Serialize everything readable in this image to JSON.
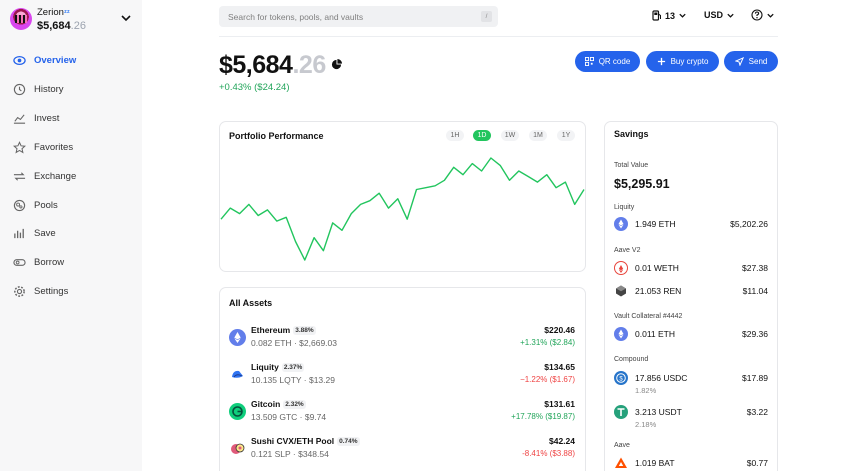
{
  "account": {
    "name": "Zerion",
    "badge": "ᶻᶻ",
    "value_main": "$5,684",
    "value_cents": ".26"
  },
  "nav": [
    {
      "label": "Overview",
      "icon": "eye-icon"
    },
    {
      "label": "History",
      "icon": "history-icon"
    },
    {
      "label": "Invest",
      "icon": "chart-line-icon"
    },
    {
      "label": "Favorites",
      "icon": "star-icon"
    },
    {
      "label": "Exchange",
      "icon": "exchange-icon"
    },
    {
      "label": "Pools",
      "icon": "pools-icon"
    },
    {
      "label": "Save",
      "icon": "bars-icon"
    },
    {
      "label": "Borrow",
      "icon": "borrow-icon"
    },
    {
      "label": "Settings",
      "icon": "gear-icon"
    }
  ],
  "search": {
    "placeholder": "Search for tokens, pools, and vaults",
    "shortcut": "/"
  },
  "topbar": {
    "gas": "13",
    "currency": "USD"
  },
  "balance": {
    "main": "$5,684",
    "cents": ".26",
    "change": "+0.43% ($24.24)"
  },
  "actions": {
    "qr": "QR code",
    "buy": "Buy crypto",
    "send": "Send"
  },
  "performance": {
    "title": "Portfolio Performance",
    "periods": [
      "1H",
      "1D",
      "1W",
      "1M",
      "1Y"
    ],
    "active_period": "1D",
    "line_color": "#22c55e"
  },
  "chart_data": {
    "type": "line",
    "title": "Portfolio Performance",
    "xlabel": "",
    "ylabel": "",
    "x": [
      0,
      1,
      2,
      3,
      4,
      5,
      6,
      7,
      8,
      9,
      10,
      11,
      12,
      13,
      14,
      15,
      16,
      17,
      18,
      19,
      20,
      21,
      22,
      23,
      24,
      25,
      26,
      27,
      28,
      29,
      30,
      31,
      32,
      33,
      34,
      35,
      36,
      37,
      38,
      39
    ],
    "y": [
      5662,
      5668,
      5665,
      5670,
      5664,
      5667,
      5661,
      5663,
      5650,
      5640,
      5652,
      5645,
      5660,
      5656,
      5665,
      5670,
      5672,
      5676,
      5668,
      5673,
      5662,
      5678,
      5679,
      5680,
      5683,
      5690,
      5686,
      5692,
      5688,
      5695,
      5691,
      5683,
      5688,
      5685,
      5682,
      5686,
      5679,
      5682,
      5670,
      5678
    ]
  },
  "assets": {
    "title": "All Assets",
    "items": [
      {
        "name": "Ethereum",
        "pct": "3.88%",
        "sub": "0.082 ETH · $2,669.03",
        "value": "$220.46",
        "delta": "+1.31% ($2.84)",
        "dir": "pos",
        "color": "#627eea"
      },
      {
        "name": "Liquity",
        "pct": "2.37%",
        "sub": "10.135 LQTY · $13.29",
        "value": "$134.65",
        "delta": "−1.22% ($1.67)",
        "dir": "neg",
        "color": "#2f74f3"
      },
      {
        "name": "Gitcoin",
        "pct": "2.32%",
        "sub": "13.509 GTC · $9.74",
        "value": "$131.61",
        "delta": "+17.78% ($19.87)",
        "dir": "pos",
        "color": "#0fce7c"
      },
      {
        "name": "Sushi CVX/ETH Pool",
        "pct": "0.74%",
        "sub": "0.121 SLP · $348.54",
        "value": "$42.24",
        "delta": "-8.41% ($3.88)",
        "dir": "neg",
        "color": "#e05a7a"
      }
    ]
  },
  "savings": {
    "title": "Savings",
    "total_label": "Total Value",
    "total": "$5,295.91",
    "groups": [
      {
        "label": "Liquity",
        "rows": [
          {
            "amount": "1.949 ETH",
            "value": "$5,202.26",
            "icon": "eth-icon",
            "color": "#627eea"
          }
        ]
      },
      {
        "label": "Aave V2",
        "rows": [
          {
            "amount": "0.01 WETH",
            "value": "$27.38",
            "icon": "weth-icon",
            "color": "#e8453c"
          },
          {
            "amount": "21.053 REN",
            "value": "$11.04",
            "icon": "ren-icon",
            "color": "#444444"
          }
        ]
      },
      {
        "label": "Vault Collateral #4442",
        "rows": [
          {
            "amount": "0.011 ETH",
            "value": "$29.36",
            "icon": "eth-icon",
            "color": "#627eea"
          }
        ]
      },
      {
        "label": "Compound",
        "rows": [
          {
            "amount": "17.856 USDC",
            "sub": "1.82%",
            "value": "$17.89",
            "icon": "usdc-icon",
            "color": "#2775ca"
          },
          {
            "amount": "3.213 USDT",
            "sub": "2.18%",
            "value": "$3.22",
            "icon": "usdt-icon",
            "color": "#26a17b"
          }
        ]
      },
      {
        "label": "Aave",
        "rows": [
          {
            "amount": "1.019 BAT",
            "value": "$0.77",
            "icon": "bat-icon",
            "color": "#ff5000"
          }
        ]
      }
    ]
  }
}
